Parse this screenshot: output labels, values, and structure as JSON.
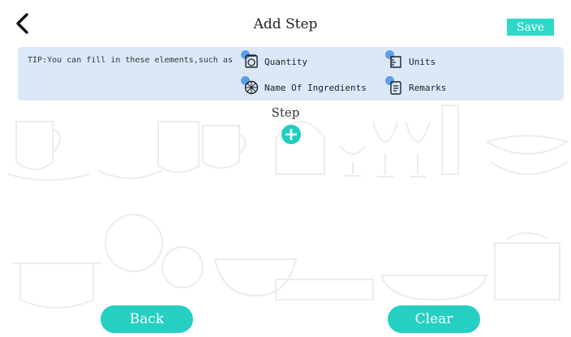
{
  "header": {
    "title": "Add Step",
    "save_label": "Save",
    "back_icon": "chevron-left-icon"
  },
  "tip": {
    "text": "TIP:You can fill in these elements,such as",
    "items": [
      {
        "label": "Quantity",
        "icon": "scale-icon"
      },
      {
        "label": "Units",
        "icon": "measuring-cup-icon"
      },
      {
        "label": "Name Of Ingredients",
        "icon": "ingredient-icon"
      },
      {
        "label": "Remarks",
        "icon": "notes-icon"
      }
    ]
  },
  "step": {
    "label": "Step",
    "add_icon": "plus-circle-icon"
  },
  "footer": {
    "back_label": "Back",
    "clear_label": "Clear"
  },
  "colors": {
    "accent": "#25cfc2",
    "tip_background": "#dbe8f8",
    "icon_dot": "#5d9ee8"
  }
}
